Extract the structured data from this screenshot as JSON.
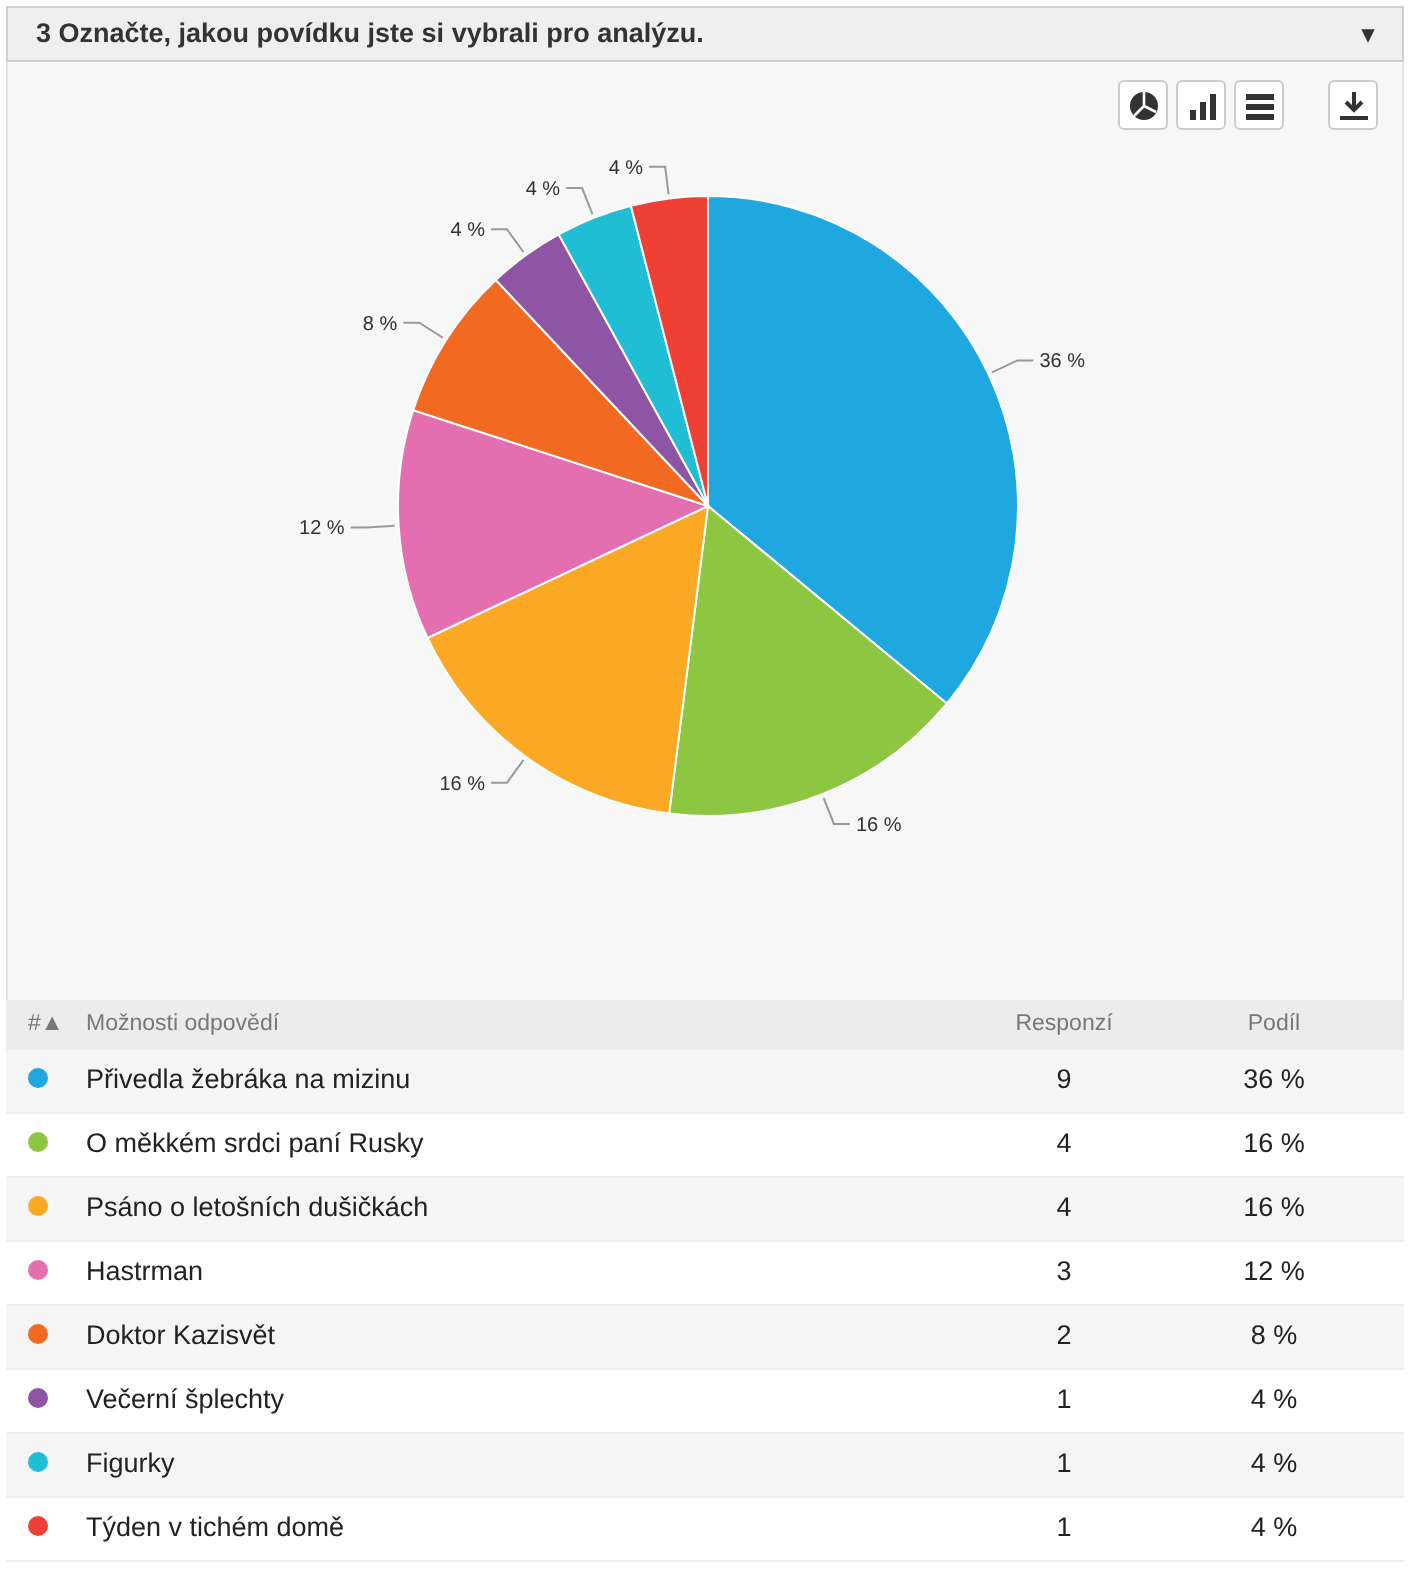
{
  "panel": {
    "title": "3 Označte, jakou povídku jste si vybrali pro analýzu.",
    "toggle": "▾"
  },
  "toolbar": [
    {
      "kind": "pie"
    },
    {
      "kind": "bar"
    },
    {
      "kind": "table"
    },
    {
      "kind": "download"
    }
  ],
  "chart_data": {
    "type": "pie",
    "values": [
      36,
      16,
      16,
      12,
      8,
      4,
      4,
      4
    ],
    "value_labels": [
      "36 %",
      "16 %",
      "16 %",
      "12 %",
      "8 %",
      "4 %",
      "4 %",
      "4 %"
    ]
  },
  "table": {
    "columns": [
      "#▲",
      "Možnosti odpovědí",
      "Responzí",
      "Podíl"
    ],
    "rows": [
      {
        "color": "#1fa7e0",
        "answer": "Přivedla žebráka na mizinu",
        "count": "9",
        "share": "36 %"
      },
      {
        "color": "#8dc641",
        "answer": "O měkkém srdci paní Rusky",
        "count": "4",
        "share": "16 %"
      },
      {
        "color": "#fba925",
        "answer": "Psáno o letošních dušičkách",
        "count": "4",
        "share": "16 %"
      },
      {
        "color": "#e46fb0",
        "answer": "Hastrman",
        "count": "3",
        "share": "12 %"
      },
      {
        "color": "#f26a22",
        "answer": "Doktor Kazisvět",
        "count": "2",
        "share": "8 %"
      },
      {
        "color": "#8f55a5",
        "answer": "Večerní šplechty",
        "count": "1",
        "share": "4 %"
      },
      {
        "color": "#1fbed4",
        "answer": "Figurky",
        "count": "1",
        "share": "4 %"
      },
      {
        "color": "#ef4036",
        "answer": "Týden v tichém domě",
        "count": "1",
        "share": "4 %"
      }
    ]
  }
}
